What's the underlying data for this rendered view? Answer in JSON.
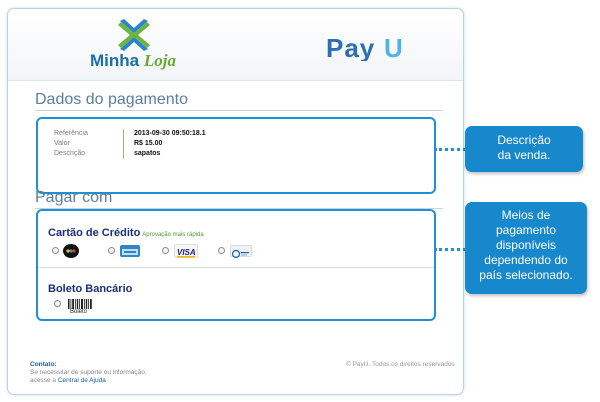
{
  "header": {
    "store_name_part1": "Minha",
    "store_name_part2": "Loja",
    "gateway_logo": "PayU"
  },
  "payment_details": {
    "title": "Dados do pagamento",
    "rows": [
      {
        "label": "Referência",
        "value": "2013-09-30 09:50:18.1"
      },
      {
        "label": "Valor",
        "value": "R$ 15.00"
      },
      {
        "label": "Descrição",
        "value": "sapatos"
      }
    ]
  },
  "pay_with": {
    "title": "Pagar com",
    "credit_card": {
      "title": "Cartão de Crédito",
      "subtitle": "Aprovação mais rápida",
      "brands": [
        "elo-icon",
        "amex-icon",
        "visa-icon",
        "diners-icon"
      ],
      "visa_text": "VISA"
    },
    "boleto": {
      "title": "Boleto Bancário",
      "icon_label": "Boleto"
    }
  },
  "footer": {
    "contact_title": "Contato:",
    "contact_line1": "Se necessitar de suporte ou informação,",
    "contact_line2_prefix": "acesse a",
    "contact_link": "Central de Ajuda",
    "copyright": "© PayU. Todos os direitos reservados"
  },
  "callouts": {
    "description": [
      "Descrição",
      "da venda."
    ],
    "methods": [
      "Meios de",
      "pagamento",
      "disponíveis",
      "dependendo do",
      "país selecionado."
    ]
  },
  "colors": {
    "accent": "#1f8fd6",
    "callout_bg": "#1888cc",
    "title_text": "#5a7e9e",
    "method_title": "#1a2f7a",
    "approval_green": "#4c9a2a"
  }
}
